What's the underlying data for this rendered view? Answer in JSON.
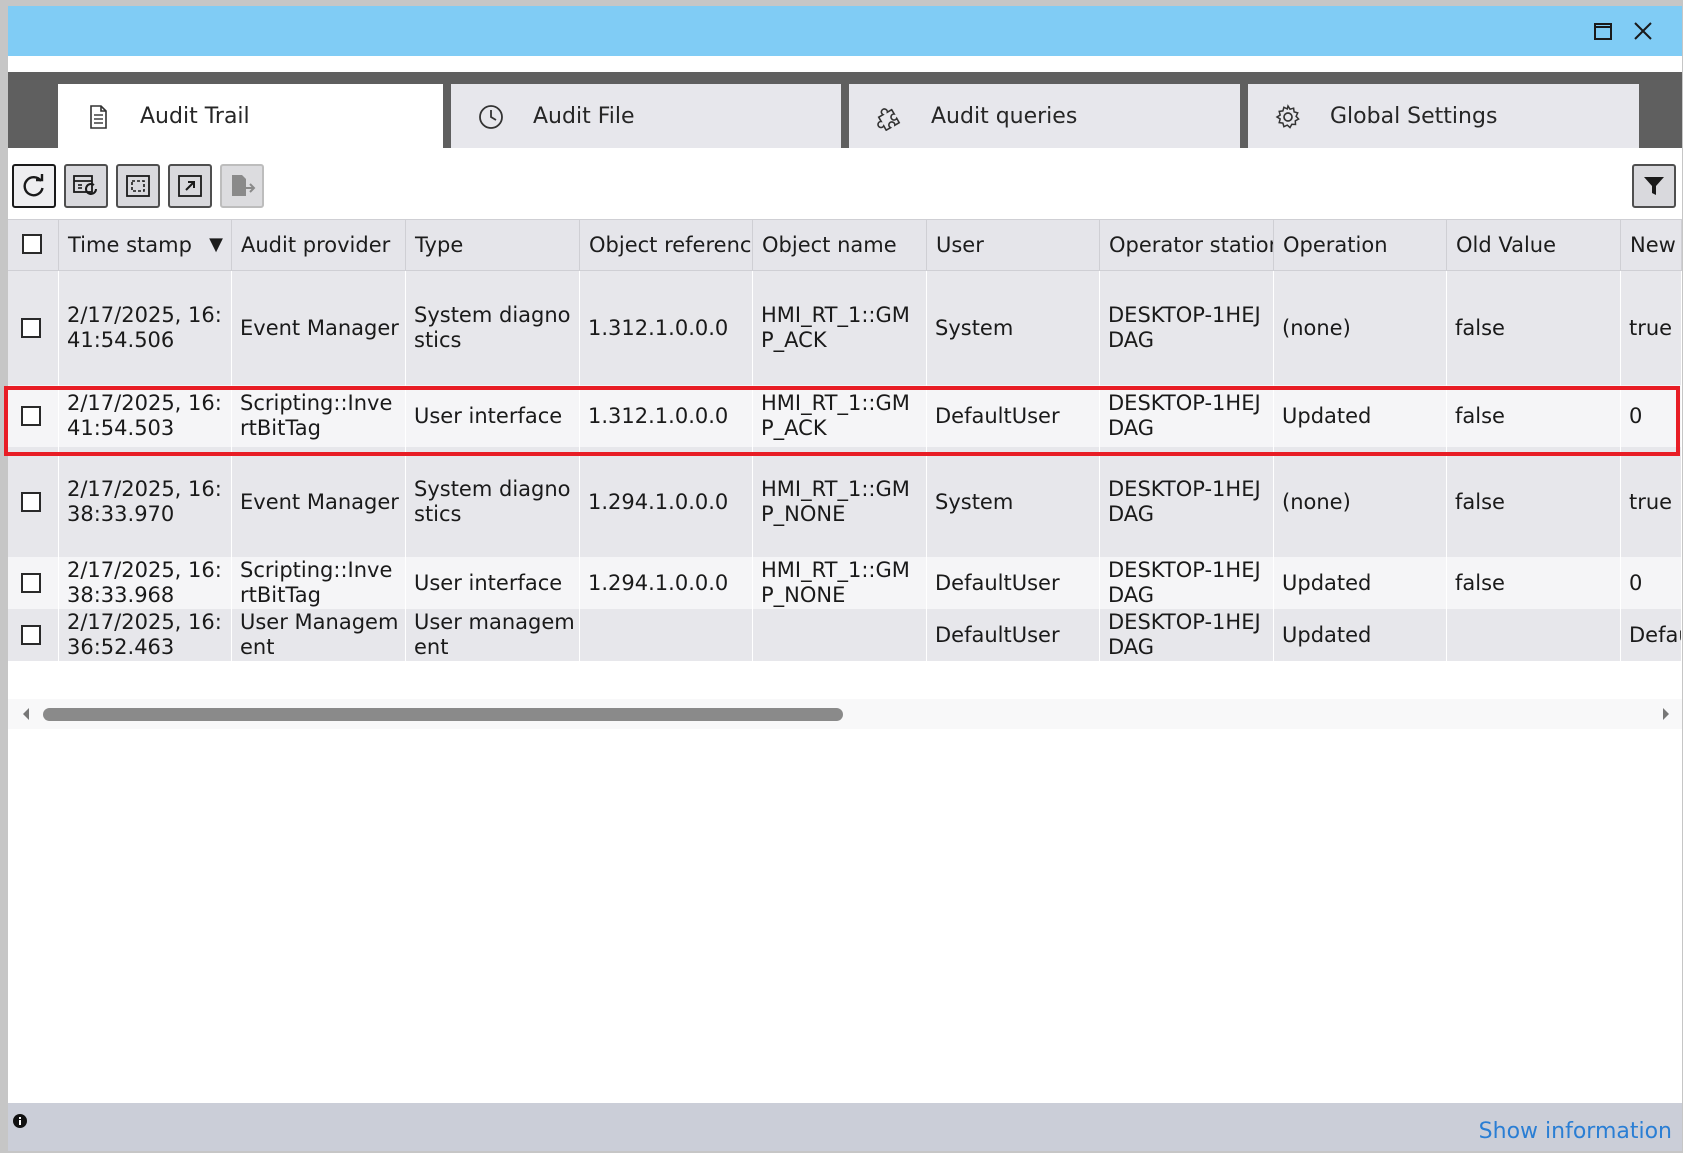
{
  "tabs": [
    {
      "label": "Audit Trail",
      "icon": "document-icon",
      "active": true
    },
    {
      "label": "Audit File",
      "icon": "clock-icon",
      "active": false
    },
    {
      "label": "Audit queries",
      "icon": "puzzle-icon",
      "active": false
    },
    {
      "label": "Global Settings",
      "icon": "gear-icon",
      "active": false
    }
  ],
  "toolbar": {
    "buttons": [
      "refresh-icon",
      "calendar-refresh-icon",
      "fit-view-icon",
      "export-view-icon",
      "export-file-icon"
    ],
    "filter_icon": "filter-icon"
  },
  "grid": {
    "headers": [
      "Time stamp",
      "Audit provider",
      "Type",
      "Object reference",
      "Object name",
      "User",
      "Operator station",
      "Operation",
      "Old Value",
      "New Value"
    ],
    "sort_indicator": "▼",
    "rows": [
      [
        "2/17/2025, 16:41:54.506",
        "Event Manager",
        "System diagnostics",
        "1.312.1.0.0.0",
        "HMI_RT_1::GMP_ACK",
        "System",
        "DESKTOP-1HEJDAG",
        "(none)",
        "false",
        "true"
      ],
      [
        "2/17/2025, 16:41:54.503",
        "Scripting::InvertBitTag",
        "User interface",
        "1.312.1.0.0.0",
        "HMI_RT_1::GMP_ACK",
        "DefaultUser",
        "DESKTOP-1HEJDAG",
        "Updated",
        "false",
        "0"
      ],
      [
        "2/17/2025, 16:38:33.970",
        "Event Manager",
        "System diagnostics",
        "1.294.1.0.0.0",
        "HMI_RT_1::GMP_NONE",
        "System",
        "DESKTOP-1HEJDAG",
        "(none)",
        "false",
        "true"
      ],
      [
        "2/17/2025, 16:38:33.968",
        "Scripting::InvertBitTag",
        "User interface",
        "1.294.1.0.0.0",
        "HMI_RT_1::GMP_NONE",
        "DefaultUser",
        "DESKTOP-1HEJDAG",
        "Updated",
        "false",
        "0"
      ],
      [
        "2/17/2025, 16:36:52.463",
        "User Management",
        "User management",
        "",
        "",
        "DefaultUser",
        "DESKTOP-1HEJDAG",
        "Updated",
        "",
        "DefaultUser"
      ]
    ],
    "highlighted_row": 2
  },
  "status": {
    "show_information": "Show information",
    "info_icon": "info-icon"
  },
  "colors": {
    "titlebar": "#80ccf5",
    "highlight": "#e81d25",
    "link": "#2a7ed4"
  }
}
